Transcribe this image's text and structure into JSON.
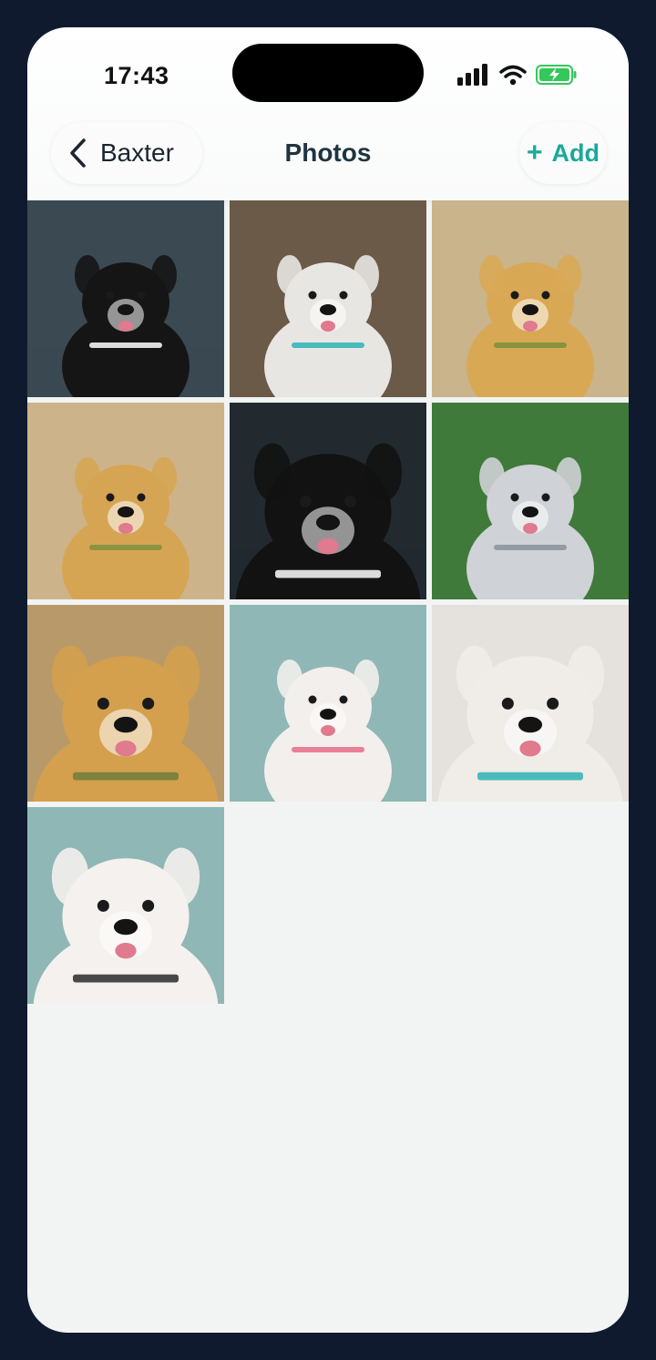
{
  "status_bar": {
    "time": "17:43"
  },
  "nav": {
    "back_label": "Baxter",
    "title": "Photos",
    "add_plus": "+",
    "add_label": "Add"
  },
  "photos": [
    {
      "subject": "border-collie",
      "bg": "#3b4a52",
      "coat": "#151515",
      "accent": "#ffffff"
    },
    {
      "subject": "aussie-puppy",
      "bg": "#6b5a48",
      "coat": "#e8e6e2",
      "accent": "#2bb3b5"
    },
    {
      "subject": "golden-retriever",
      "bg": "#c9b48c",
      "coat": "#d9a855",
      "accent": "#7a8e3a"
    },
    {
      "subject": "golden-retriever",
      "bg": "#cdb38a",
      "coat": "#d6a553",
      "accent": "#7c8f3d"
    },
    {
      "subject": "border-collie-closeup",
      "bg": "#222a30",
      "coat": "#121212",
      "accent": "#ffffff"
    },
    {
      "subject": "husky",
      "bg": "#3f7a3a",
      "coat": "#cfd2d6",
      "accent": "#8a9299"
    },
    {
      "subject": "golden-retriever-closeup",
      "bg": "#b89a6a",
      "coat": "#d4a04e",
      "accent": "#6e7d38"
    },
    {
      "subject": "bulldog",
      "bg": "#8fb7b5",
      "coat": "#f2efec",
      "accent": "#e86c8a"
    },
    {
      "subject": "aussie-closeup",
      "bg": "#e5e1dc",
      "coat": "#f0ece8",
      "accent": "#2bb3b5"
    },
    {
      "subject": "bulldog-closeup",
      "bg": "#8fb7b5",
      "coat": "#f4f1ee",
      "accent": "#2a2a2a"
    }
  ]
}
